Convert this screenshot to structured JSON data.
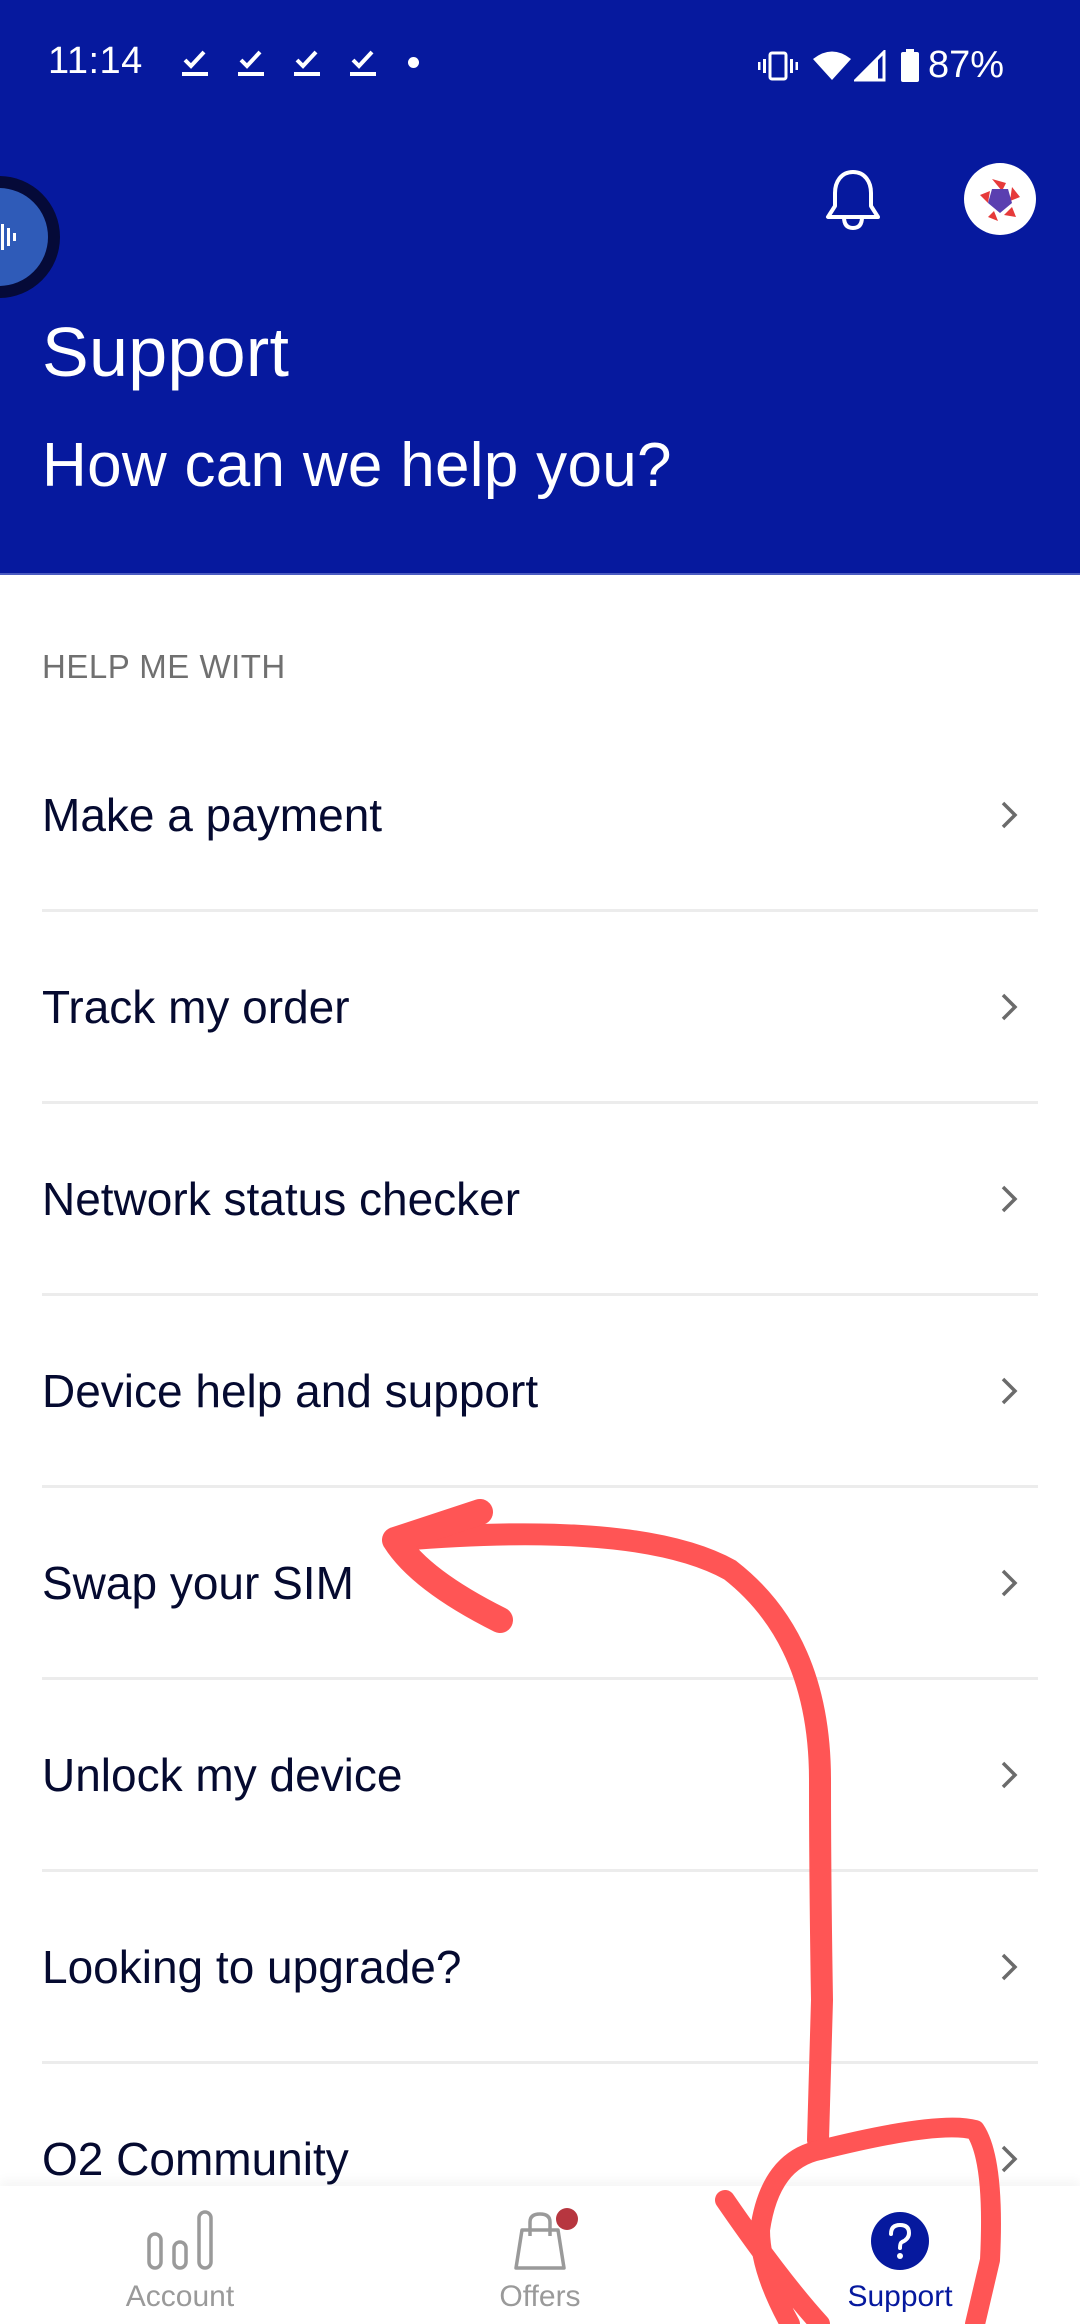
{
  "status_bar": {
    "time": "11:14",
    "notification_icons": [
      "download-done-icon",
      "download-done-icon",
      "download-done-icon",
      "download-done-icon",
      "more-notifications-dot"
    ],
    "system_icons": [
      "vibrate-icon",
      "wifi-icon",
      "cellular-signal-icon",
      "battery-icon"
    ],
    "battery_percent": "87%"
  },
  "header": {
    "title": "Support",
    "subtitle": "How can we help you?",
    "bell_icon": "bell-icon",
    "avatar_icon": "profile-avatar",
    "assistant_icon": "voice-assistant-icon",
    "background_color": "#06199e"
  },
  "help_section": {
    "label": "HELP ME WITH",
    "items": [
      {
        "label": "Make a payment"
      },
      {
        "label": "Track my order"
      },
      {
        "label": "Network status checker"
      },
      {
        "label": "Device help and support"
      },
      {
        "label": "Swap your SIM"
      },
      {
        "label": "Unlock my device"
      },
      {
        "label": "Looking to upgrade?"
      },
      {
        "label": "O2 Community"
      }
    ]
  },
  "bottom_nav": {
    "tabs": [
      {
        "label": "Account",
        "icon": "account-bars-icon",
        "active": false
      },
      {
        "label": "Offers",
        "icon": "shopping-bag-icon",
        "active": false,
        "badge": true
      },
      {
        "label": "Support",
        "icon": "help-question-icon",
        "active": true
      }
    ]
  },
  "annotation": {
    "description": "Hand-drawn red arrow from circled Support tab pointing to 'Swap your SIM'",
    "color": "#ff5555"
  }
}
